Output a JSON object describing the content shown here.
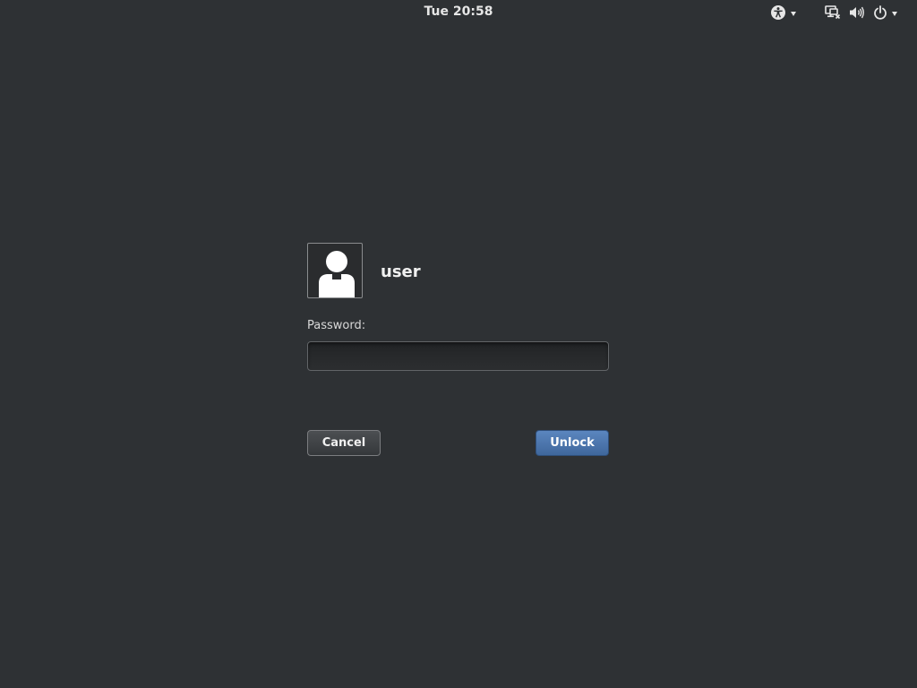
{
  "top_bar": {
    "clock": "Tue 20:58",
    "indicators": [
      {
        "icon": "accessibility-icon",
        "has_menu": true
      },
      {
        "icon": "network-wired-disconnected-icon"
      },
      {
        "icon": "volume-icon"
      },
      {
        "icon": "power-icon",
        "has_menu": true
      }
    ]
  },
  "unlock_dialog": {
    "avatar_icon": "user-avatar-icon",
    "username": "user",
    "password_label": "Password:",
    "password_value": "",
    "cancel_label": "Cancel",
    "unlock_label": "Unlock"
  },
  "colors": {
    "background": "#2e3134",
    "unlock_button": "#4a73aa",
    "text": "#eeeeec"
  }
}
